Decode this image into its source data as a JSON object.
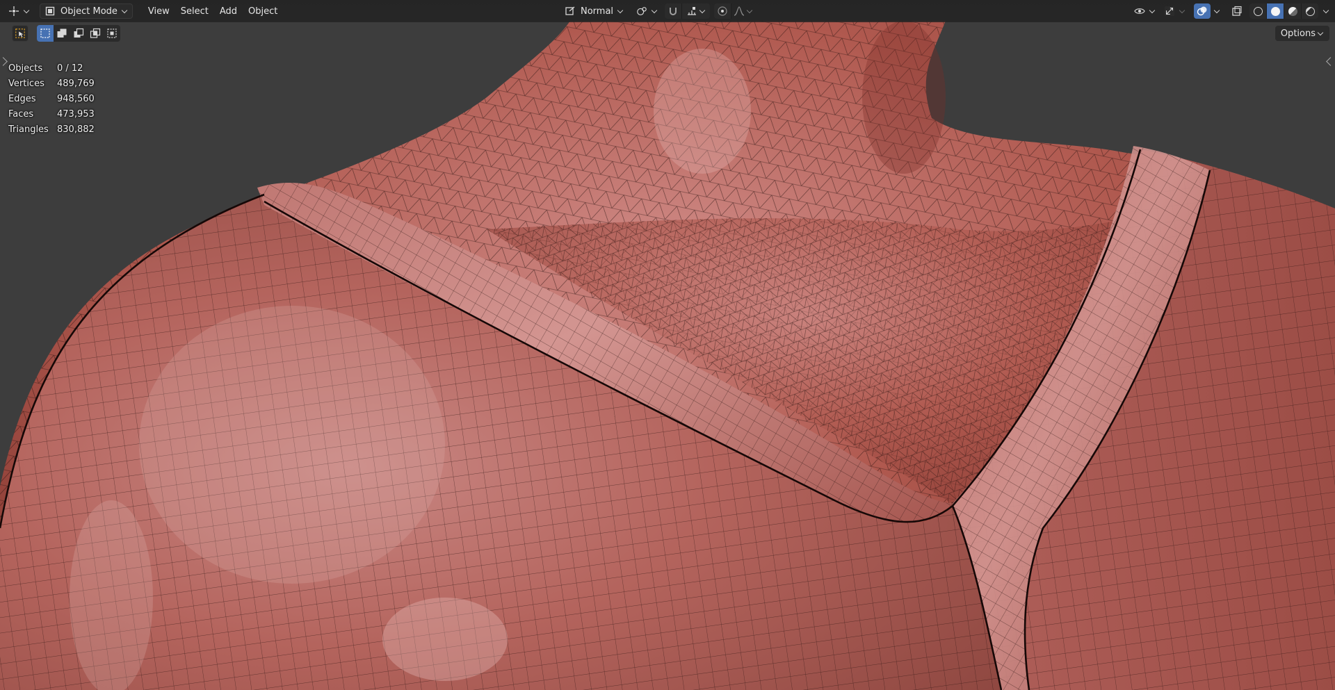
{
  "header": {
    "editor_icon": "editor-type-icon",
    "mode_label": "Object Mode",
    "menus": [
      "View",
      "Select",
      "Add",
      "Object"
    ],
    "orientation_label": "Normal",
    "pivot_icon": "pivot-point-icon",
    "snap_icon": "snap-magnet-icon",
    "proportional_icon": "proportional-edit-icon",
    "falloff_icon": "falloff-curve-icon",
    "visibility_icon": "visibility-eye-icon",
    "gizmo_icon": "gizmo-icon",
    "overlay_icon": "overlays-icon",
    "xray_icon": "xray-icon",
    "shading_modes": [
      "wireframe",
      "solid",
      "material",
      "rendered"
    ],
    "active_shading": "solid"
  },
  "toolbar": {
    "options_label": "Options",
    "select_modes": [
      "new",
      "extend",
      "subtract",
      "intersect",
      "invert"
    ]
  },
  "stats": {
    "rows": [
      {
        "label": "Objects",
        "value": "0 / 12"
      },
      {
        "label": "Vertices",
        "value": "489,769"
      },
      {
        "label": "Edges",
        "value": "948,560"
      },
      {
        "label": "Faces",
        "value": "473,953"
      },
      {
        "label": "Triangles",
        "value": "830,882"
      }
    ]
  },
  "colors": {
    "header_bg": "#232323",
    "viewport_bg": "#3d3d3d",
    "mesh_base": "#b5605a",
    "accent_blue": "#4772b3"
  }
}
